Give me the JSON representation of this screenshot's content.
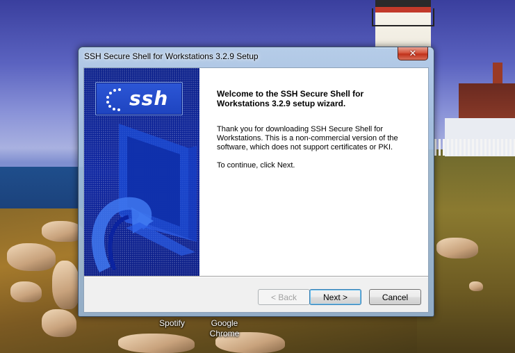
{
  "desktop": {
    "icons": [
      {
        "label": "Spotify"
      },
      {
        "label": "Google\nChrome"
      }
    ]
  },
  "window": {
    "title": "SSH Secure Shell for Workstations 3.2.9 Setup",
    "close_glyph": "✕",
    "logo_text": "ssh",
    "welcome_title": "Welcome to the SSH Secure Shell for Workstations 3.2.9 setup wizard.",
    "welcome_body": "Thank you for downloading SSH Secure Shell for Workstations. This is a non-commercial version of the software, which does not support certificates or PKI.",
    "welcome_continue": "To continue, click Next.",
    "buttons": {
      "back": "< Back",
      "next": "Next >",
      "cancel": "Cancel"
    }
  },
  "colors": {
    "graphic_blue": "#0b23a0",
    "close_red": "#c0311a",
    "default_button_border": "#3c7fb1"
  }
}
